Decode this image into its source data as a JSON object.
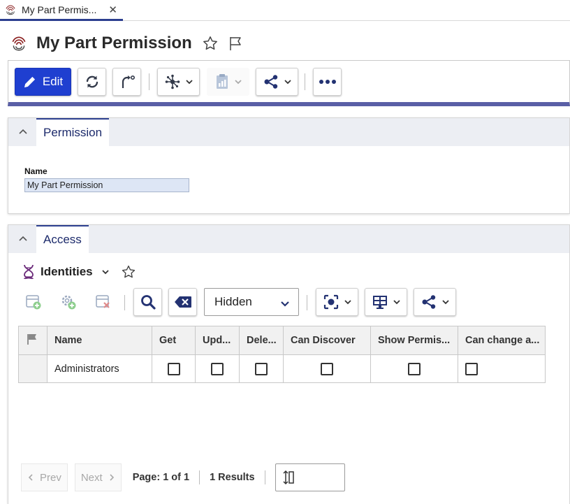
{
  "tab": {
    "title": "My Part Permis...",
    "close": "✕"
  },
  "page": {
    "title": "My Part Permission"
  },
  "toolbar": {
    "edit_label": "Edit"
  },
  "permission_panel": {
    "tab_label": "Permission",
    "name_label": "Name",
    "name_value": "My Part Permission"
  },
  "access_panel": {
    "tab_label": "Access",
    "identities_label": "Identities",
    "view_select": "Hidden",
    "columns": [
      "Name",
      "Get",
      "Upd...",
      "Dele...",
      "Can Discover",
      "Show Permis...",
      "Can change a..."
    ],
    "rows": [
      {
        "name": "Administrators",
        "get": false,
        "update": false,
        "delete": false,
        "discover": false,
        "show_permissions": false,
        "change_access": false
      }
    ]
  },
  "pager": {
    "prev": "Prev",
    "next": "Next",
    "page_info": "Page: 1 of 1",
    "results": "1 Results"
  },
  "colors": {
    "accent": "#2c3f8f",
    "primary_button": "#1f3fd0",
    "toolbar_band": "#5a5fa6",
    "field_bg": "#dde6f5"
  }
}
